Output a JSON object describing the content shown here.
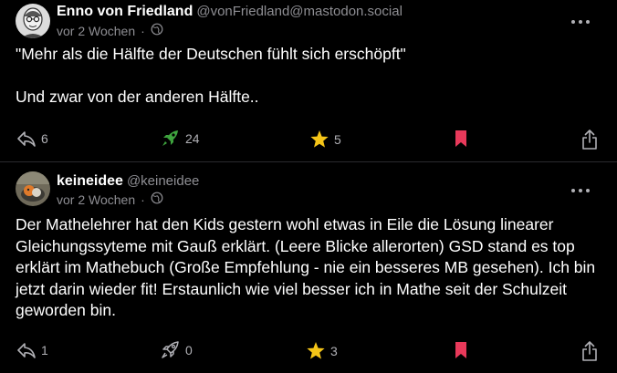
{
  "posts": [
    {
      "author_name": "Enno von Friedland",
      "handle": "@vonFriedland@mastodon.social",
      "timestamp": "vor 2 Wochen",
      "visibility_icon": "globe-icon",
      "content": "\"Mehr als die Hälfte der Deutschen fühlt sich erschöpft\"\n\nUnd zwar von der anderen Hälfte..",
      "replies": "6",
      "boosts": "24",
      "favourites": "5",
      "boosted": true,
      "favourited": true,
      "bookmarked": true
    },
    {
      "author_name": "keineidee",
      "handle": "@keineidee",
      "timestamp": "vor 2 Wochen",
      "visibility_icon": "globe-icon",
      "content": "Der Mathelehrer hat den Kids gestern wohl etwas in Eile die Lösung linearer Gleichungssyteme mit Gauß erklärt. (Leere Blicke allerorten) GSD stand es top erklärt im Mathebuch (Große Empfehlung - nie ein besseres MB gesehen). Ich bin jetzt darin wieder fit! Erstaunlich wie viel besser ich in Mathe seit der Schulzeit geworden bin.",
      "replies": "1",
      "boosts": "0",
      "favourites": "3",
      "boosted": false,
      "favourited": true,
      "bookmarked": true
    }
  ],
  "colors": {
    "background": "#000000",
    "boost_active": "#3fa53f",
    "favourite_active": "#f5c518",
    "bookmark_active": "#e8395a",
    "secondary_text": "#8e8e93"
  }
}
